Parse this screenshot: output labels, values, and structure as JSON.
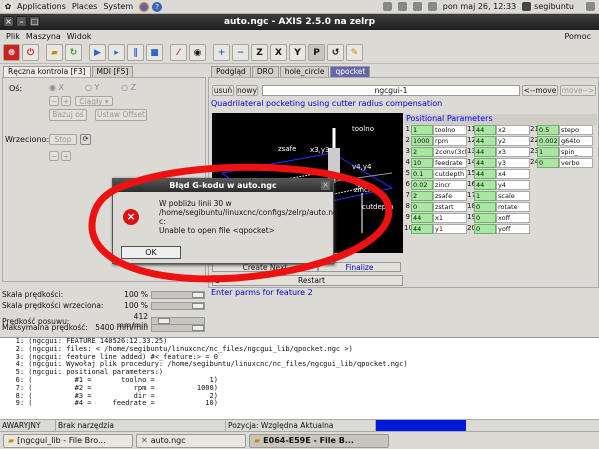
{
  "top_panel": {
    "menus": [
      "Applications",
      "Places",
      "System"
    ],
    "datetime": "pon maj 26, 12:33",
    "user": "segibuntu"
  },
  "window": {
    "title": "auto.ngc - AXIS 2.5.0 na zelrp"
  },
  "menubar": {
    "items": [
      "Plik",
      "Maszyna",
      "Widok"
    ],
    "help": "Pomoc"
  },
  "toolbar": {
    "letters": [
      "Z",
      "X",
      "Y",
      "P"
    ]
  },
  "left_tabs": [
    "Ręczna kontrola [F3]",
    "MDI [F5]"
  ],
  "manual": {
    "axis_label": "Oś:",
    "axes": [
      "X",
      "Y",
      "Z"
    ],
    "jog_mode": "Ciągły",
    "home_button": "Bazuj oś",
    "touch_off_button": "Ustaw Offset",
    "spindle_label": "Wrzeciono:",
    "stop_button": "Stop"
  },
  "overrides": [
    {
      "label": "Skala prędkości:",
      "value": "100 %",
      "level": 1.0
    },
    {
      "label": "Skala prędkości wrzeciona:",
      "value": "100 %",
      "level": 1.0
    },
    {
      "label": "Prędkość posuwu:",
      "value": "412 mm/min",
      "level": 0.15
    },
    {
      "label": "Maksymalna prędkość:",
      "value": "5400 mm/min",
      "level": 1.0
    }
  ],
  "right_tabs": [
    "Podgląd",
    "DRO",
    "hole_circle",
    "qpocket"
  ],
  "ngcgui": {
    "remove_button": "usuń",
    "new_button": "nowy",
    "page_name": "ngcgui-1",
    "move_left": "<--move",
    "move_right": "move-->",
    "description": "Quadrilateral pocketing using cutter radius compensation",
    "preview_labels": [
      "toolno",
      "zsafe",
      "x3,y3",
      "v4,y4",
      "zincr",
      "cutdepth"
    ],
    "params_header": "Positional Parameters",
    "params": [
      [
        [
          "1",
          "1",
          "toolno"
        ],
        [
          "11",
          "44",
          "x2"
        ],
        [
          "21",
          "0.5",
          "stepo"
        ]
      ],
      [
        [
          "2",
          "1000",
          "rpm"
        ],
        [
          "12",
          "44",
          "y2"
        ],
        [
          "22",
          "0.002",
          "g64to"
        ]
      ],
      [
        [
          "3",
          "2",
          "2conv(3climb"
        ],
        [
          "13",
          "44",
          "x3"
        ],
        [
          "23",
          "1",
          "spin_"
        ]
      ],
      [
        [
          "4",
          "10",
          "feedrate"
        ],
        [
          "14",
          "44",
          "y3"
        ],
        [
          "24",
          "0",
          "verbo"
        ]
      ],
      [
        [
          "5",
          "0.1",
          "cutdepth"
        ],
        [
          "15",
          "44",
          "x4"
        ],
        [
          "",
          "",
          " "
        ]
      ],
      [
        [
          "6",
          "0.02",
          "zincr"
        ],
        [
          "16",
          "44",
          "y4"
        ],
        [
          "",
          "",
          " "
        ]
      ],
      [
        [
          "7",
          "2",
          "zsafe"
        ],
        [
          "17",
          "1",
          "scale"
        ],
        [
          "",
          "",
          " "
        ]
      ],
      [
        [
          "8",
          "0",
          "zstart"
        ],
        [
          "18",
          "0",
          "rotate"
        ],
        [
          "",
          "",
          " "
        ]
      ],
      [
        [
          "9",
          "44",
          "x1"
        ],
        [
          "19",
          "0",
          "xoff"
        ],
        [
          "",
          "",
          " "
        ]
      ],
      [
        [
          "10",
          "44",
          "y1"
        ],
        [
          "20",
          "0",
          "yoff"
        ],
        [
          "",
          "",
          " "
        ]
      ]
    ],
    "create_next": "Create Next",
    "finalize": "Finalize",
    "restart_num": "1",
    "restart": "Restart",
    "status_msg": "Enter parms for feature 2"
  },
  "log_lines": [
    "   1: (ngcgui: FEATURE 140526:12.33.25)",
    "   2: (ngcgui: files: < /home/segibuntu/linuxcnc/nc_files/ngcgui_lib/qpocket.ngc >)",
    "   3: (ngcgui: feature line added) #<_feature:> = 0",
    "   4: (ngcgui: Wywołaj plik procedury: /home/segibuntu/linuxcnc/nc_files/ngcgui_lib/qpocket.ngc)",
    "   5: (ngcgui: positional parameters:)",
    "   6: (          #1 =       toolno =             1)",
    "   7: (          #2 =          rpm =          1000)",
    "   8: (          #3 =          dir =             2)",
    "   9: (          #4 =     feedrate =            10)"
  ],
  "status": {
    "estop": "AWARYJNY",
    "tool": "Brak narzędzia",
    "position": "Pozycja: Względna Aktualna"
  },
  "taskbar": [
    {
      "label": "[ngcgui_lib - File Bro...",
      "active": false
    },
    {
      "label": "auto.ngc",
      "active": false
    },
    {
      "label": "E064-E59E - File B...",
      "active": true
    }
  ],
  "dialog": {
    "title": "Błąd G-kodu w auto.ngc",
    "lines": [
      "W pobliżu linii 30 w",
      "/home/segibuntu/linuxcnc/configs/zelrp/auto.ng",
      "c:",
      "Unable to open file <qpocket>"
    ],
    "ok": "OK"
  },
  "colors": {
    "accent": "#0000cc",
    "param_value": "#a8e8a0",
    "error_red": "#ee1111",
    "dro_blue": "#0018d8"
  }
}
